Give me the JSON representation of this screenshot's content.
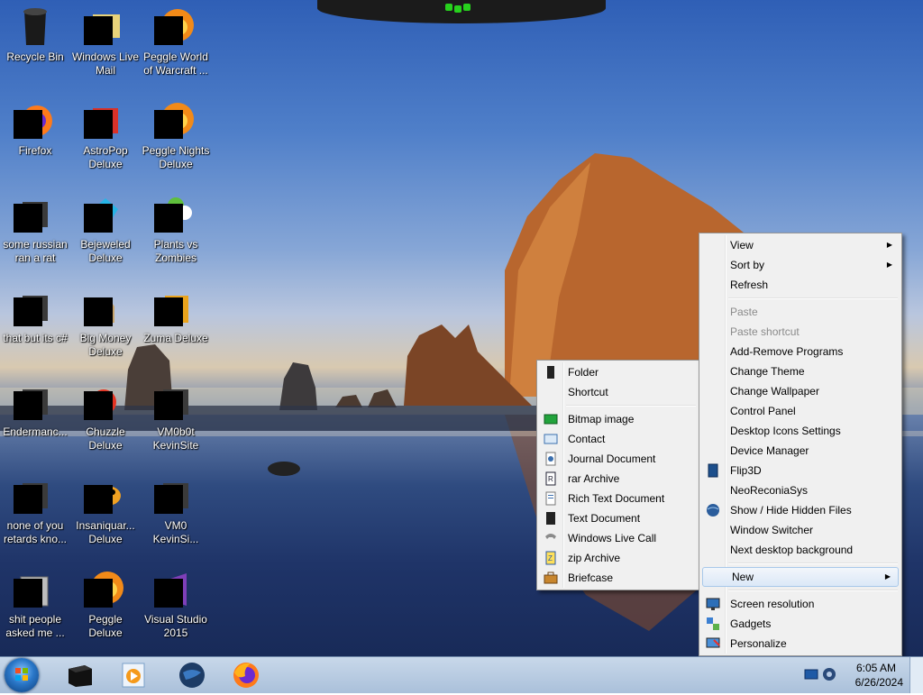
{
  "desktop_icons": [
    {
      "label": "Recycle Bin",
      "icon": "recycle-bin-icon"
    },
    {
      "label": "Windows Live Mail",
      "icon": "mail-icon"
    },
    {
      "label": "Peggle World of Warcraft ...",
      "icon": "peggle-icon"
    },
    {
      "label": "Firefox",
      "icon": "firefox-icon"
    },
    {
      "label": "AstroPop Deluxe",
      "icon": "game-icon"
    },
    {
      "label": "Peggle Nights Deluxe",
      "icon": "peggle-icon"
    },
    {
      "label": "some russian ran a rat",
      "icon": "app-icon"
    },
    {
      "label": "Bejeweled Deluxe",
      "icon": "gem-icon"
    },
    {
      "label": "Plants vs Zombies",
      "icon": "plant-icon"
    },
    {
      "label": "that but its c#",
      "icon": "app-icon"
    },
    {
      "label": "Big Money Deluxe",
      "icon": "money-bag-icon"
    },
    {
      "label": "Zuma Deluxe",
      "icon": "zuma-icon"
    },
    {
      "label": "Endermanc...",
      "icon": "app-icon"
    },
    {
      "label": "Chuzzle Deluxe",
      "icon": "chuzzle-icon"
    },
    {
      "label": "VM0b0t KevinSite",
      "icon": "app-icon"
    },
    {
      "label": "none of you retards kno...",
      "icon": "app-icon"
    },
    {
      "label": "Insaniquar... Deluxe",
      "icon": "fish-icon"
    },
    {
      "label": "VM0 KevinSi...",
      "icon": "app-icon"
    },
    {
      "label": "shit people asked me ...",
      "icon": "folder-icon"
    },
    {
      "label": "Peggle Deluxe",
      "icon": "peggle-icon"
    },
    {
      "label": "Visual Studio 2015",
      "icon": "visual-studio-icon"
    }
  ],
  "context_menu": {
    "items": [
      {
        "label": "View",
        "submenu": true,
        "disabled": false
      },
      {
        "label": "Sort by",
        "submenu": true,
        "disabled": false
      },
      {
        "label": "Refresh",
        "submenu": false,
        "disabled": false
      },
      {
        "separator": true
      },
      {
        "label": "Paste",
        "submenu": false,
        "disabled": true
      },
      {
        "label": "Paste shortcut",
        "submenu": false,
        "disabled": true
      },
      {
        "label": "Add-Remove Programs",
        "submenu": false,
        "disabled": false
      },
      {
        "label": "Change Theme",
        "submenu": false,
        "disabled": false
      },
      {
        "label": "Change Wallpaper",
        "submenu": false,
        "disabled": false
      },
      {
        "label": "Control Panel",
        "submenu": false,
        "disabled": false
      },
      {
        "label": "Desktop Icons Settings",
        "submenu": false,
        "disabled": false
      },
      {
        "label": "Device Manager",
        "submenu": false,
        "disabled": false
      },
      {
        "label": "Flip3D",
        "submenu": false,
        "disabled": false,
        "icon": "flip3d-icon"
      },
      {
        "label": "NeoReconiaSys",
        "submenu": false,
        "disabled": false
      },
      {
        "label": "Show / Hide Hidden Files",
        "submenu": false,
        "disabled": false,
        "icon": "globe-icon"
      },
      {
        "label": "Window Switcher",
        "submenu": false,
        "disabled": false
      },
      {
        "label": "Next desktop background",
        "submenu": false,
        "disabled": false
      },
      {
        "separator": true
      },
      {
        "label": "New",
        "submenu": true,
        "disabled": false,
        "highlighted": true
      },
      {
        "separator": true
      },
      {
        "label": "Screen resolution",
        "submenu": false,
        "disabled": false,
        "icon": "monitor-icon"
      },
      {
        "label": "Gadgets",
        "submenu": false,
        "disabled": false,
        "icon": "gadgets-icon"
      },
      {
        "label": "Personalize",
        "submenu": false,
        "disabled": false,
        "icon": "personalize-icon"
      }
    ]
  },
  "new_submenu": {
    "items": [
      {
        "label": "Folder",
        "icon": "folder-icon"
      },
      {
        "label": "Shortcut",
        "icon": ""
      },
      {
        "separator": true
      },
      {
        "label": "Bitmap image",
        "icon": "bitmap-icon"
      },
      {
        "label": "Contact",
        "icon": "contact-icon"
      },
      {
        "label": "Journal Document",
        "icon": "journal-icon"
      },
      {
        "label": "rar Archive",
        "icon": "rar-icon"
      },
      {
        "label": "Rich Text Document",
        "icon": "rtf-icon"
      },
      {
        "label": "Text Document",
        "icon": "text-document-icon"
      },
      {
        "label": "Windows Live Call",
        "icon": "phone-icon"
      },
      {
        "label": "zip Archive",
        "icon": "zip-icon"
      },
      {
        "label": "Briefcase",
        "icon": "briefcase-icon"
      }
    ]
  },
  "taskbar": {
    "start_icon": "windows-start-icon",
    "pinned": [
      {
        "name": "taskbar-app-dark",
        "icon": "dark-box-icon"
      },
      {
        "name": "taskbar-app-media",
        "icon": "media-player-icon"
      },
      {
        "name": "taskbar-app-globe",
        "icon": "globe-icon"
      },
      {
        "name": "taskbar-app-firefox",
        "icon": "firefox-icon"
      }
    ],
    "clock": {
      "time": "6:05 AM",
      "date": "6/26/2024"
    }
  },
  "colors": {
    "menu_bg": "#f0f0f0",
    "menu_border": "#979797",
    "highlight_border": "#a8c8ea",
    "taskbar_bg": "#b8cce2",
    "desktop_label": "#ffffff"
  }
}
